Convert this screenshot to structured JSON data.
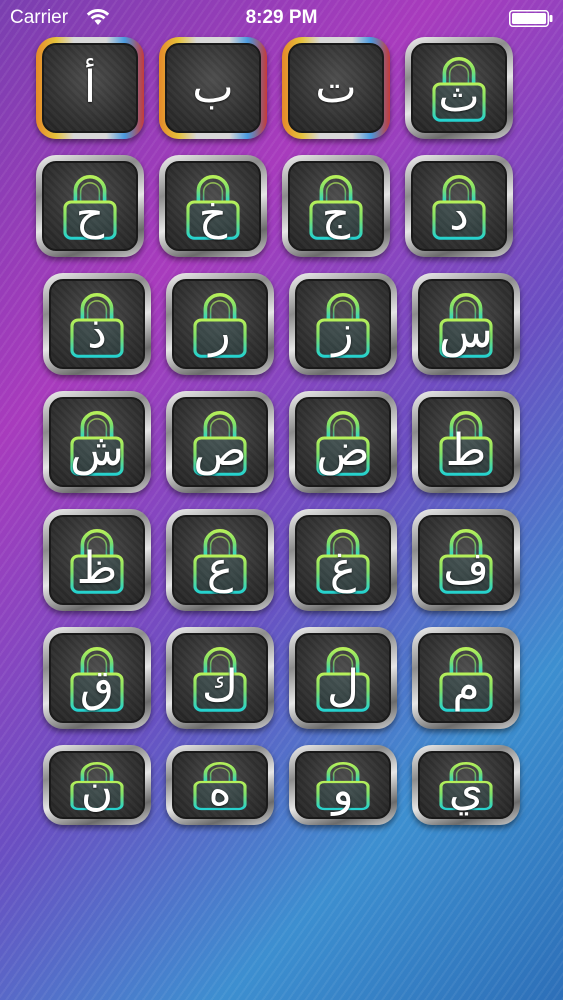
{
  "status_bar": {
    "carrier": "Carrier",
    "time": "8:29 PM"
  },
  "colors": {
    "lock_glow_top": "#9be04a",
    "lock_glow_bottom": "#2ad3d0",
    "tile_dark": "#303030"
  },
  "letters": [
    {
      "char": "أ",
      "locked": false
    },
    {
      "char": "ب",
      "locked": false
    },
    {
      "char": "ت",
      "locked": false
    },
    {
      "char": "ث",
      "locked": true
    },
    {
      "char": "ح",
      "locked": true
    },
    {
      "char": "خ",
      "locked": true
    },
    {
      "char": "ج",
      "locked": true
    },
    {
      "char": "د",
      "locked": true
    },
    {
      "char": "ذ",
      "locked": true
    },
    {
      "char": "ر",
      "locked": true
    },
    {
      "char": "ز",
      "locked": true
    },
    {
      "char": "س",
      "locked": true
    },
    {
      "char": "ش",
      "locked": true
    },
    {
      "char": "ص",
      "locked": true
    },
    {
      "char": "ض",
      "locked": true
    },
    {
      "char": "ط",
      "locked": true
    },
    {
      "char": "ظ",
      "locked": true
    },
    {
      "char": "ع",
      "locked": true
    },
    {
      "char": "غ",
      "locked": true
    },
    {
      "char": "ف",
      "locked": true
    },
    {
      "char": "ق",
      "locked": true
    },
    {
      "char": "ك",
      "locked": true
    },
    {
      "char": "ل",
      "locked": true
    },
    {
      "char": "م",
      "locked": true
    },
    {
      "char": "ن",
      "locked": true
    },
    {
      "char": "ه",
      "locked": true
    },
    {
      "char": "و",
      "locked": true
    },
    {
      "char": "ي",
      "locked": true
    }
  ]
}
